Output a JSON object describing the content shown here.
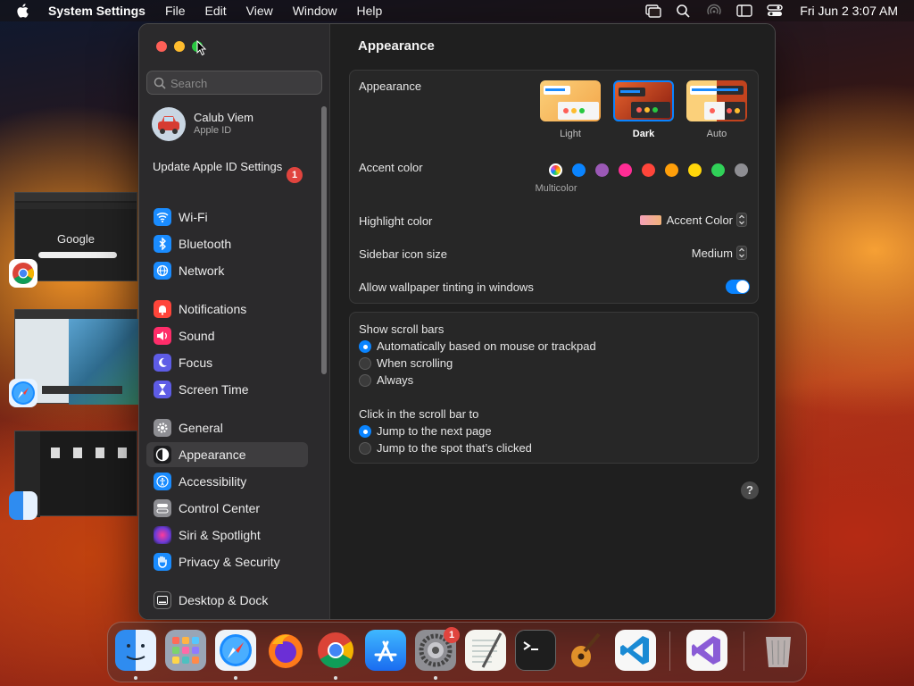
{
  "menubar": {
    "app_name": "System Settings",
    "items": [
      "File",
      "Edit",
      "View",
      "Window",
      "Help"
    ],
    "clock": "Fri Jun 2  3:07 AM"
  },
  "sidebar": {
    "search_placeholder": "Search",
    "profile_name": "Calub Viem",
    "profile_sub": "Apple ID",
    "update_label": "Update Apple ID Settings",
    "update_badge": "1",
    "items": [
      {
        "label": "Wi-Fi",
        "color": "#1a8cff"
      },
      {
        "label": "Bluetooth",
        "color": "#1a8cff"
      },
      {
        "label": "Network",
        "color": "#1a8cff"
      },
      {
        "label": "Notifications",
        "color": "#ff453a"
      },
      {
        "label": "Sound",
        "color": "#ff2d6a"
      },
      {
        "label": "Focus",
        "color": "#5e5ce6"
      },
      {
        "label": "Screen Time",
        "color": "#5e5ce6"
      },
      {
        "label": "General",
        "color": "#8e8e93"
      },
      {
        "label": "Appearance",
        "color": "#1c1c1e"
      },
      {
        "label": "Accessibility",
        "color": "#1a8cff"
      },
      {
        "label": "Control Center",
        "color": "#8e8e93"
      },
      {
        "label": "Siri & Spotlight",
        "color": "#a64fd6"
      },
      {
        "label": "Privacy & Security",
        "color": "#1a8cff"
      },
      {
        "label": "Desktop & Dock",
        "color": "#2c2c2e"
      }
    ]
  },
  "main": {
    "title": "Appearance",
    "appearance_label": "Appearance",
    "modes": [
      "Light",
      "Dark",
      "Auto"
    ],
    "selected_mode": "Dark",
    "accent_label": "Accent color",
    "accent_caption": "Multicolor",
    "accent_colors": [
      "#0a84ff",
      "#9b59b6",
      "#ff2d95",
      "#ff453a",
      "#ff9f0a",
      "#ffd60a",
      "#30d158",
      "#8e8e93"
    ],
    "highlight_label": "Highlight color",
    "highlight_value": "Accent Color",
    "sidebar_icon_label": "Sidebar icon size",
    "sidebar_icon_value": "Medium",
    "tint_label": "Allow wallpaper tinting in windows",
    "tint_on": true,
    "scroll_title": "Show scroll bars",
    "scroll_options": [
      "Automatically based on mouse or trackpad",
      "When scrolling",
      "Always"
    ],
    "click_title": "Click in the scroll bar to",
    "click_options": [
      "Jump to the next page",
      "Jump to the spot that’s clicked"
    ],
    "help": "?"
  },
  "dock": {
    "badge": "1",
    "apps": [
      "Finder",
      "Launchpad",
      "Safari",
      "Firefox",
      "Chrome",
      "App Store",
      "System Settings",
      "TextEdit",
      "Terminal",
      "GarageBand",
      "Visual Studio Code",
      "Visual Studio",
      "Trash"
    ]
  },
  "windows_preview": {
    "google_text": "Google"
  }
}
